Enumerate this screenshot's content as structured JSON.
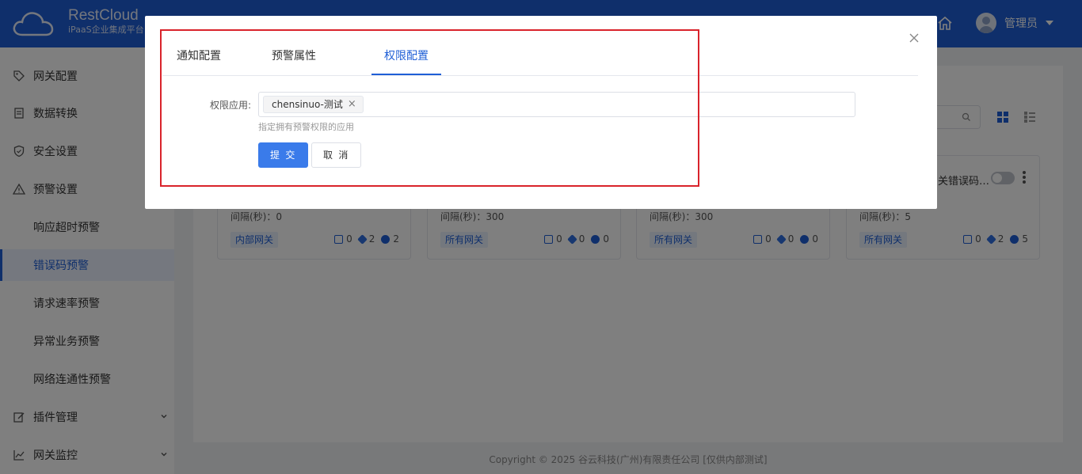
{
  "header": {
    "brand_name": "RestCloud",
    "brand_sub": "iPaaS企业集成平台",
    "user_name": "管理员"
  },
  "sidebar": {
    "items": [
      {
        "label": "网关配置"
      },
      {
        "label": "数据转换"
      },
      {
        "label": "安全设置"
      },
      {
        "label": "预警设置"
      },
      {
        "label": "响应超时预警"
      },
      {
        "label": "错误码预警"
      },
      {
        "label": "请求速率预警"
      },
      {
        "label": "异常业务预警"
      },
      {
        "label": "网络连通性预警"
      },
      {
        "label": "插件管理"
      },
      {
        "label": "网关监控"
      }
    ]
  },
  "cards": [
    {
      "interval": "间隔(秒)：0",
      "tag": "内部网关",
      "stats": [
        "0",
        "2",
        "2"
      ]
    },
    {
      "interval": "间隔(秒)：300",
      "tag": "所有网关",
      "stats": [
        "0",
        "0",
        "0"
      ]
    },
    {
      "interval": "间隔(秒)：300",
      "tag": "所有网关",
      "stats": [
        "0",
        "0",
        "0"
      ]
    },
    {
      "title": "关错误码…",
      "interval": "间隔(秒)：5",
      "tag": "所有网关",
      "stats": [
        "0",
        "2",
        "5"
      ]
    }
  ],
  "footer": {
    "text": "Copyright © 2025 谷云科技(广州)有限责任公司 [仅供内部测试]"
  },
  "dialog": {
    "tabs": [
      {
        "label": "通知配置"
      },
      {
        "label": "预警属性"
      },
      {
        "label": "权限配置"
      }
    ],
    "active_tab": "权限配置",
    "form": {
      "label": "权限应用:",
      "selected": "chensinuo-测试",
      "helper": "指定拥有预警权限的应用"
    },
    "submit_label": "提 交",
    "cancel_label": "取 消"
  },
  "colors": {
    "primary": "#1f5fd6",
    "highlight": "#d9232b"
  }
}
